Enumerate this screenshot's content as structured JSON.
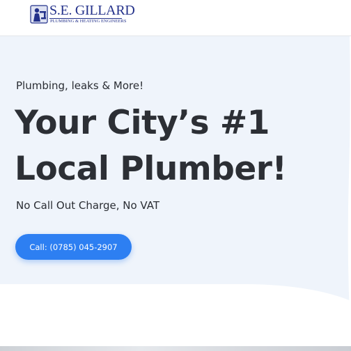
{
  "header": {
    "logo": {
      "name": "S.E. GILLARD",
      "tagline": "Plumbing & Heating Engineers",
      "emblem_icon": "plumber-emblem-icon"
    }
  },
  "hero": {
    "eyebrow": "Plumbing, leaks & More!",
    "headline_line1": "Your City’s #1",
    "headline_line2": "Local Plumber!",
    "subline": "No Call Out Charge, No VAT",
    "cta_label": "Call: (0785) 045-2907"
  },
  "colors": {
    "brand_navy": "#23318a",
    "accent_blue": "#2d7ff2",
    "hero_background": "#eff4fb",
    "text_dark": "#2c2f35"
  }
}
